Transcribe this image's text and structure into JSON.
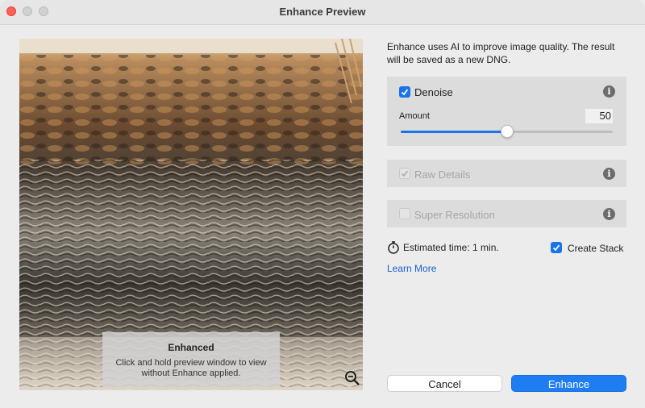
{
  "window": {
    "title": "Enhance Preview"
  },
  "preview": {
    "overlay_title": "Enhanced",
    "overlay_description": "Click and hold preview window to view without Enhance applied.",
    "zoom_icon": "zoom-out-icon"
  },
  "description": "Enhance uses AI to improve image quality. The result will be saved as a new DNG.",
  "denoise": {
    "label": "Denoise",
    "checked": true,
    "amount_label": "Amount",
    "amount_value": "50",
    "amount_fraction": 0.5
  },
  "raw_details": {
    "label": "Raw Details",
    "checked": true,
    "enabled": false
  },
  "super_resolution": {
    "label": "Super Resolution",
    "checked": false,
    "enabled": false
  },
  "estimated_time": "Estimated time: 1 min.",
  "create_stack": {
    "label": "Create Stack",
    "checked": true
  },
  "learn_more": "Learn More",
  "buttons": {
    "cancel": "Cancel",
    "enhance": "Enhance"
  },
  "colors": {
    "accent": "#1f7df2",
    "close": "#ff5f57",
    "link": "#1a5fd0"
  }
}
